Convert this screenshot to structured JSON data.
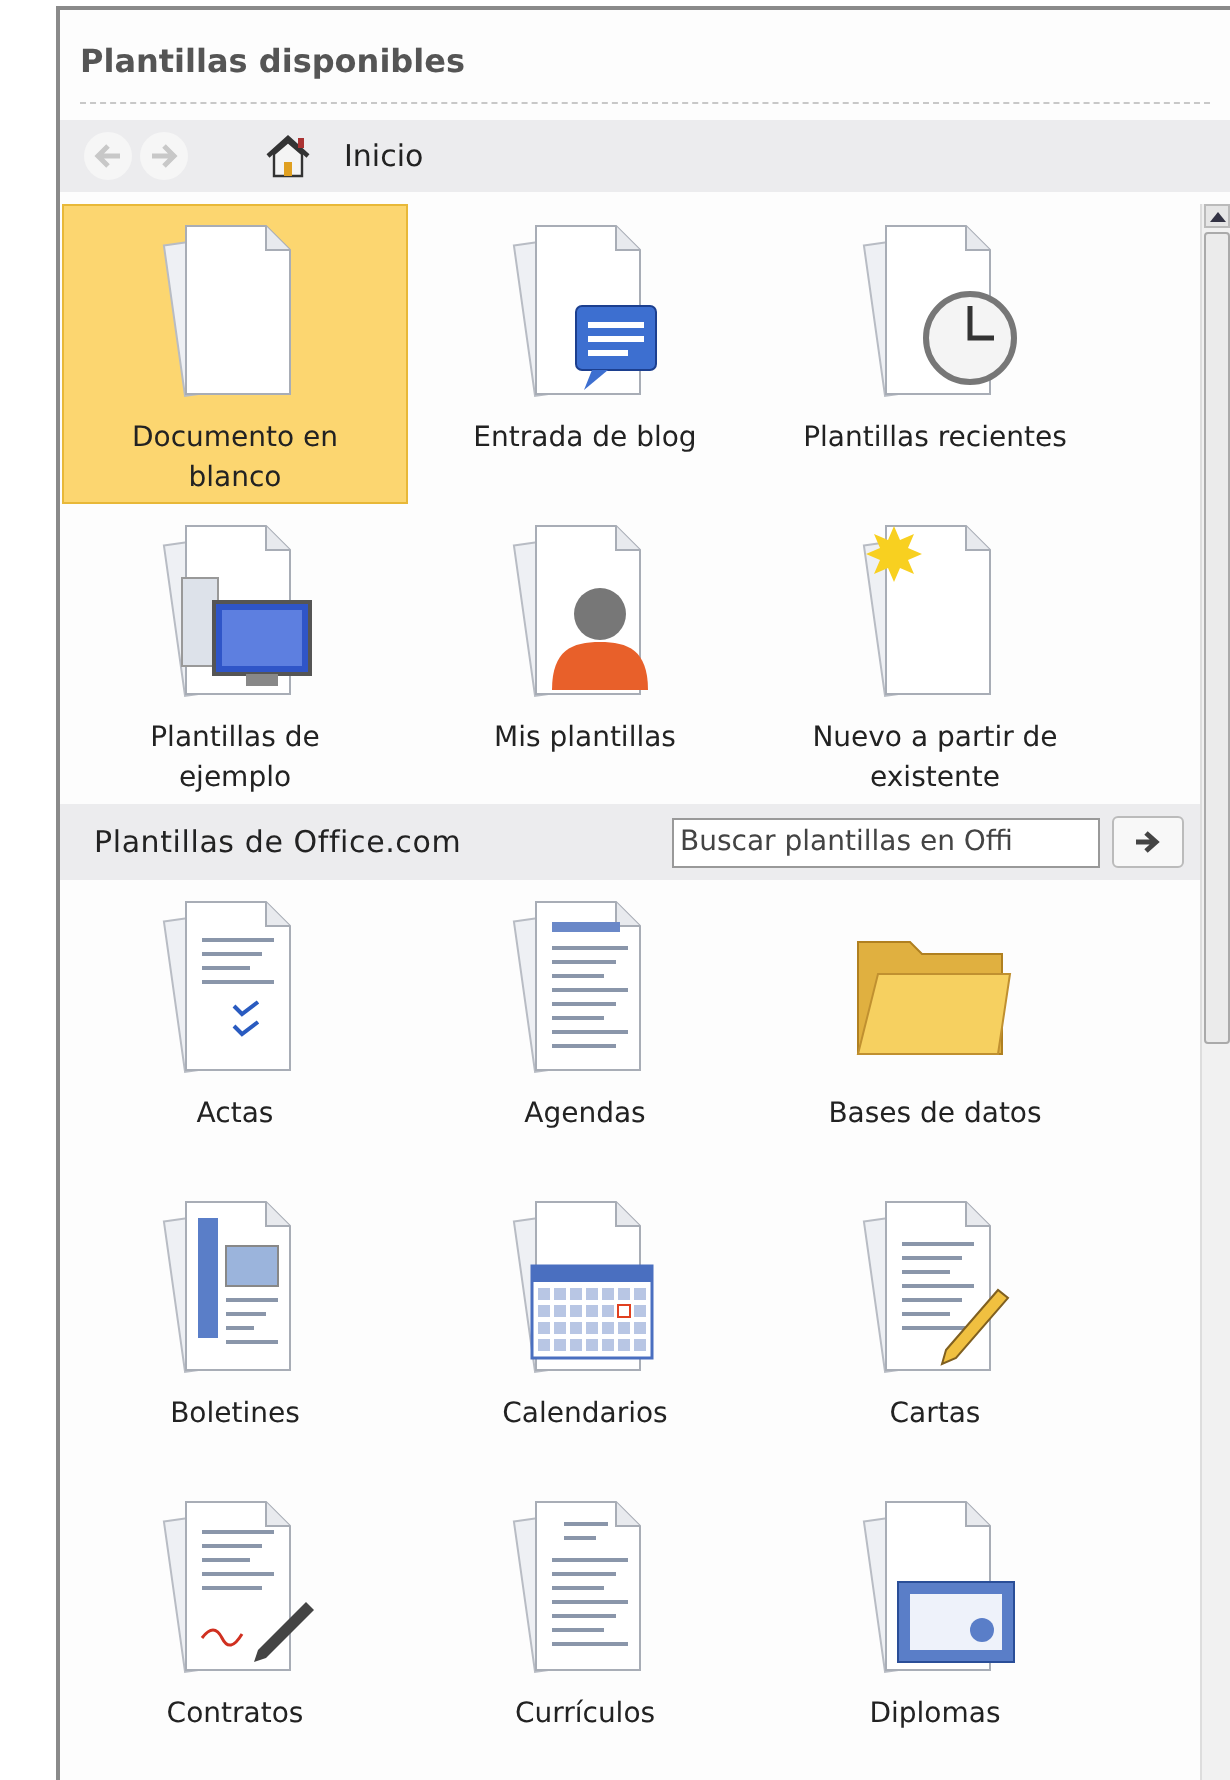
{
  "title": "Plantillas disponibles",
  "nav": {
    "back_disabled": true,
    "forward_disabled": true,
    "location": "Inicio"
  },
  "local_templates": [
    {
      "label": "Documento en blanco",
      "kind": "blank",
      "selected": true
    },
    {
      "label": "Entrada de blog",
      "kind": "blog",
      "selected": false
    },
    {
      "label": "Plantillas recientes",
      "kind": "recent",
      "selected": false
    },
    {
      "label": "Plantillas de ejemplo",
      "kind": "sample",
      "selected": false
    },
    {
      "label": "Mis plantillas",
      "kind": "mine",
      "selected": false
    },
    {
      "label": "Nuevo a partir de existente",
      "kind": "new",
      "selected": false
    }
  ],
  "office": {
    "title": "Plantillas de Office.com",
    "search": {
      "placeholder": "Buscar plantillas en Offi"
    },
    "categories": [
      {
        "label": "Actas",
        "kind": "actas",
        "selected": false
      },
      {
        "label": "Agendas",
        "kind": "agendas",
        "selected": false
      },
      {
        "label": "Bases de datos",
        "kind": "folder",
        "selected": false
      },
      {
        "label": "Boletines",
        "kind": "boletines",
        "selected": false
      },
      {
        "label": "Calendarios",
        "kind": "calendar",
        "selected": false
      },
      {
        "label": "Cartas",
        "kind": "cartas",
        "selected": false
      },
      {
        "label": "Contratos",
        "kind": "contratos",
        "selected": false
      },
      {
        "label": "Currículos",
        "kind": "curriculos",
        "selected": false
      },
      {
        "label": "Diplomas",
        "kind": "diplomas",
        "selected": false
      }
    ]
  }
}
